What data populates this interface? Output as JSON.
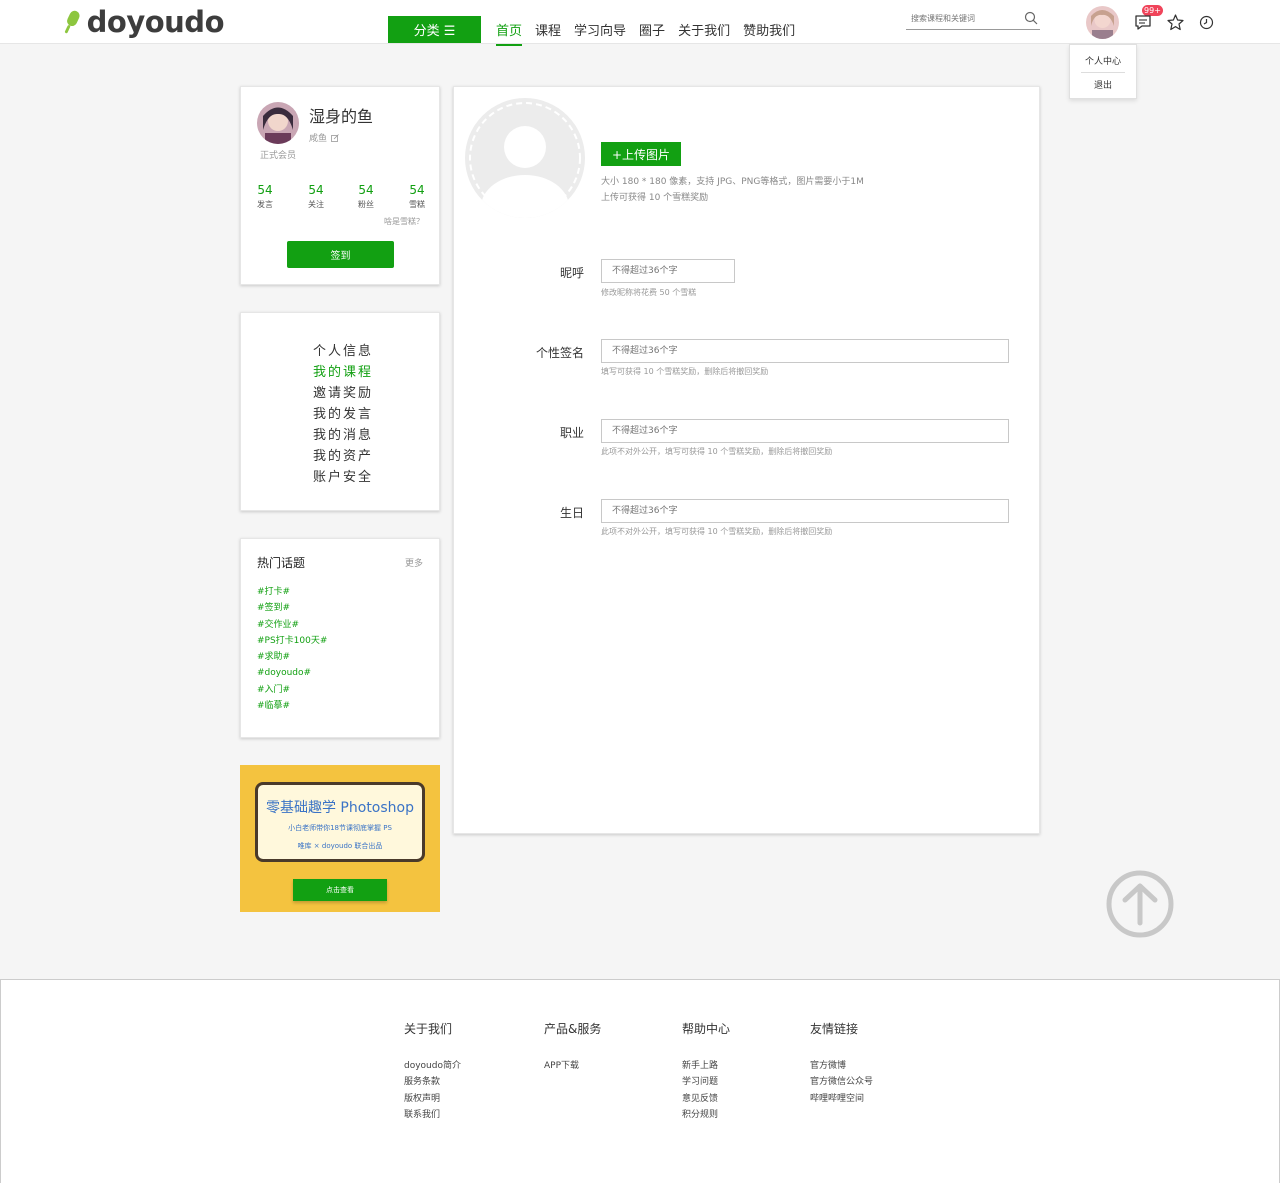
{
  "header": {
    "logo": "doyoudo",
    "category_btn": "分类 ☰",
    "nav": [
      "首页",
      "课程",
      "学习向导",
      "圈子",
      "关于我们",
      "赞助我们"
    ],
    "search_placeholder": "搜索课程和关键词",
    "badge": "99+"
  },
  "dropdown": {
    "item1": "个人中心",
    "item2": "退出"
  },
  "profile": {
    "name": "湿身的鱼",
    "sub": "咸鱼",
    "level": "正式会员",
    "stats": [
      {
        "value": "54",
        "label": "发言"
      },
      {
        "value": "54",
        "label": "关注"
      },
      {
        "value": "54",
        "label": "粉丝"
      },
      {
        "value": "54",
        "label": "雪糕"
      }
    ],
    "what_link": "啥是雪糕？",
    "checkin": "签到"
  },
  "menu": [
    "个人信息",
    "我的课程",
    "邀请奖励",
    "我的发言",
    "我的消息",
    "我的资产",
    "账户安全"
  ],
  "topics": {
    "title": "热门话题",
    "more": "更多",
    "items": [
      "#打卡#",
      "#签到#",
      "#交作业#",
      "#PS打卡100天#",
      "#求助#",
      "#doyoudo#",
      "#入门#",
      "#临摹#"
    ]
  },
  "ad": {
    "title": "零基础趣学 Photoshop",
    "sub": "小白老师带你18节课彻底掌握 PS",
    "foot": "唯库 × doyoudo 联合出品",
    "btn": "点击查看"
  },
  "form": {
    "upload_btn": "+上传图片",
    "upload_hint1": "大小 180 * 180 像素，支持 JPG、PNG等格式，图片需要小于1M",
    "upload_hint2": "上传可获得 10 个雪糕奖励",
    "fields": [
      {
        "label": "昵呼",
        "placeholder": "不得超过36个字",
        "hint": "修改昵称将花费 50 个雪糕"
      },
      {
        "label": "个性签名",
        "placeholder": "不得超过36个字",
        "hint": "填写可获得 10 个雪糕奖励，删除后将撤回奖励"
      },
      {
        "label": "职业",
        "placeholder": "不得超过36个字",
        "hint": "此项不对外公开，填写可获得 10 个雪糕奖励，删除后将撤回奖励"
      },
      {
        "label": "生日",
        "placeholder": "不得超过36个字",
        "hint": "此项不对外公开，填写可获得 10 个雪糕奖励，删除后将撤回奖励"
      }
    ]
  },
  "footer": {
    "cols": [
      {
        "title": "关于我们",
        "links": [
          "doyoudo简介",
          "服务条款",
          "版权声明",
          "联系我们"
        ]
      },
      {
        "title": "产品&服务",
        "links": [
          "APP下载"
        ]
      },
      {
        "title": "帮助中心",
        "links": [
          "新手上路",
          "学习问题",
          "意见反馈",
          "积分规则"
        ]
      },
      {
        "title": "友情链接",
        "links": [
          "官方微博",
          "官方微信公众号",
          "哔哩哔哩空间"
        ]
      }
    ]
  },
  "colors": {
    "accent": "#12a012",
    "badge": "#f0445a",
    "ad_bg": "#f4c33f"
  }
}
